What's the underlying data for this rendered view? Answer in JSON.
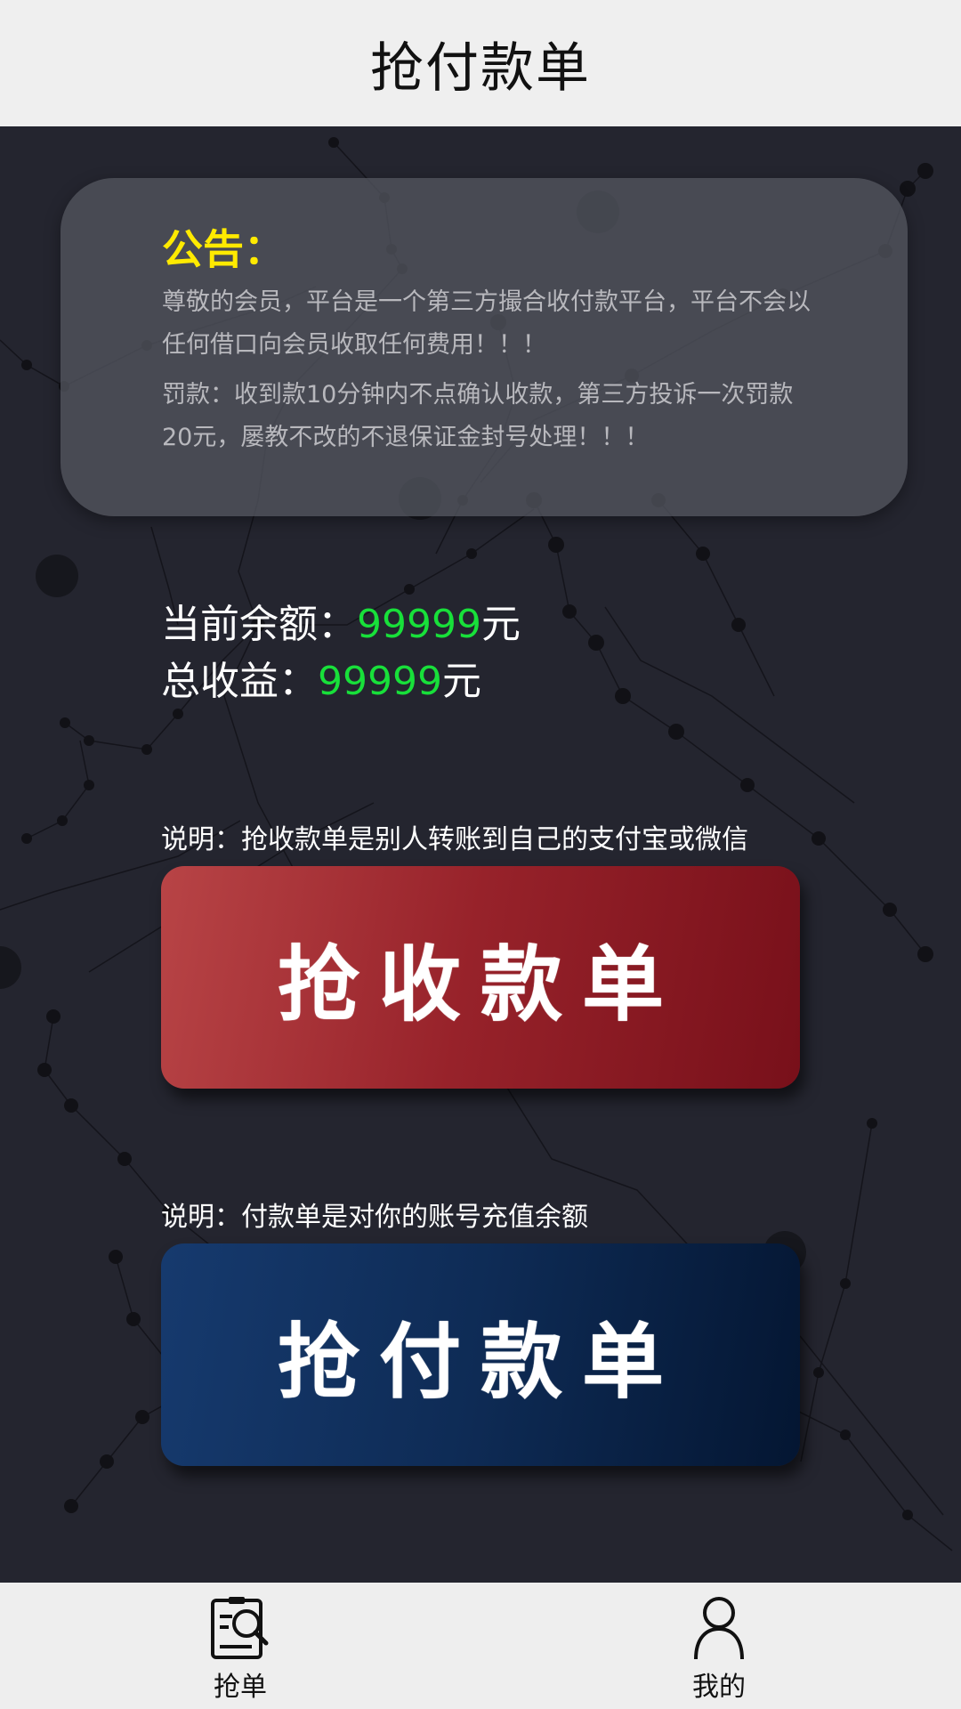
{
  "header": {
    "title": "抢付款单"
  },
  "notice": {
    "title": "公告：",
    "paragraph1": "尊敬的会员，平台是一个第三方撮合收付款平台，平台不会以任何借口向会员收取任何费用！！！",
    "paragraph2": "罚款：收到款10分钟内不点确认收款，第三方投诉一次罚款20元，屡教不改的不退保证金封号处理！！！"
  },
  "balance": {
    "current_label": "当前余额：",
    "current_value": "99999",
    "current_unit": "元",
    "total_label": "总收益：",
    "total_value": "99999",
    "total_unit": "元"
  },
  "receive": {
    "note": "说明：抢收款单是别人转账到自己的支付宝或微信",
    "button_label": "抢收款单"
  },
  "pay": {
    "note": "说明：付款单是对你的账号充值余额",
    "button_label": "抢付款单"
  },
  "bottom_nav": {
    "items": [
      {
        "label": "抢单",
        "icon": "order-search-icon"
      },
      {
        "label": "我的",
        "icon": "user-profile-icon"
      }
    ]
  },
  "colors": {
    "background": "#24252f",
    "notice_title": "#ffea00",
    "amount": "#18e03a",
    "receive_button": "#97222a",
    "pay_button": "#0e2b55"
  }
}
